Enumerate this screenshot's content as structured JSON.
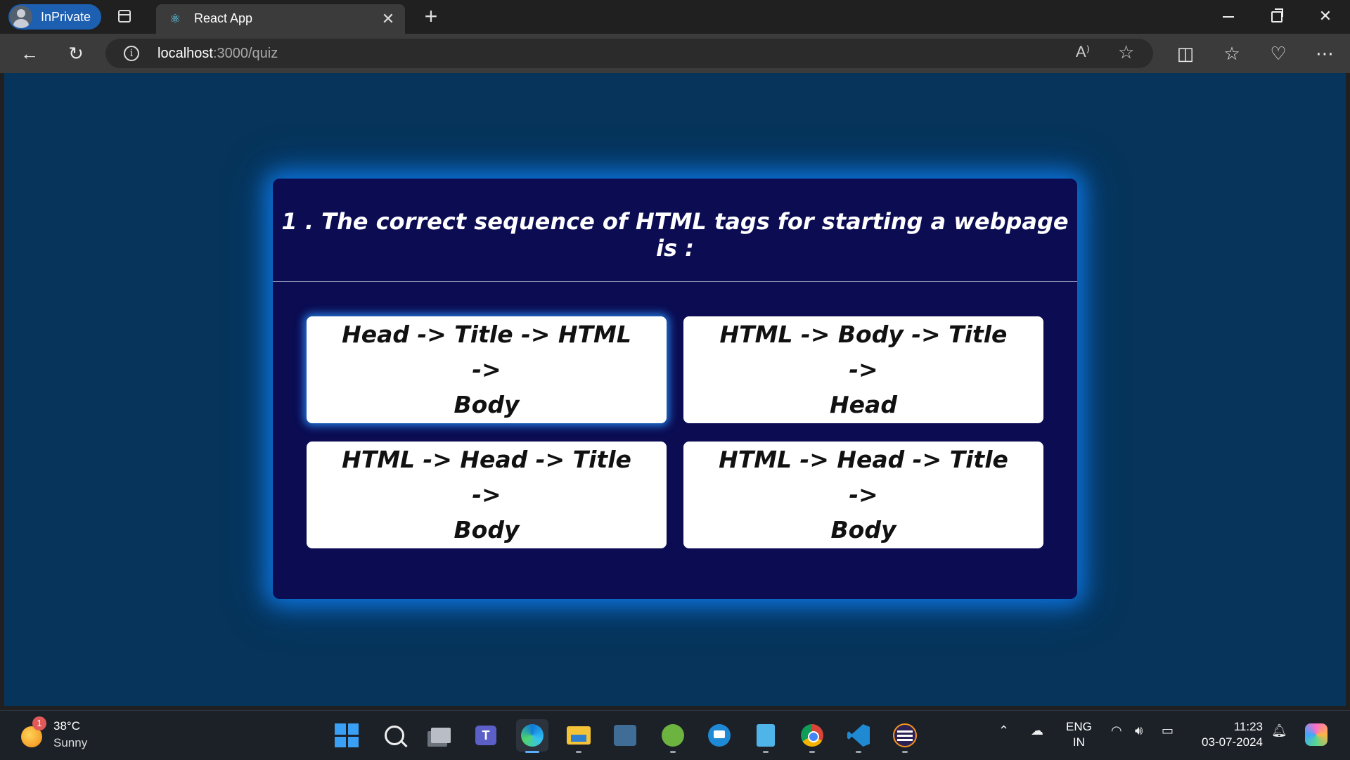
{
  "browser": {
    "profile_label": "InPrivate",
    "tab": {
      "title": "React App",
      "icon": "react-icon"
    },
    "address": {
      "host": "localhost",
      "path": ":3000/quiz"
    },
    "read_aloud_label": "A⁾",
    "window_controls": [
      "minimize",
      "restore",
      "close"
    ]
  },
  "quiz": {
    "question": "1 . The correct sequence of HTML tags for starting a webpage is :",
    "options": [
      {
        "line1": "Head -> Title -> HTML ->",
        "line2": "Body"
      },
      {
        "line1": "HTML -> Body -> Title ->",
        "line2": "Head"
      },
      {
        "line1": "HTML -> Head -> Title ->",
        "line2": "Body"
      },
      {
        "line1": "HTML -> Head -> Title ->",
        "line2": "Body"
      }
    ],
    "highlight_color": "#2896ff",
    "card_color": "#0b0c52",
    "page_bg": "#06345a"
  },
  "taskbar": {
    "weather": {
      "temp": "38°C",
      "condition": "Sunny",
      "badge": "1"
    },
    "language": {
      "line1": "ENG",
      "line2": "IN"
    },
    "clock": {
      "time": "11:23",
      "date": "03-07-2024"
    },
    "apps": [
      "start-icon",
      "search-icon",
      "task-view-icon",
      "teams-icon",
      "edge-icon",
      "file-explorer-icon",
      "mysql-workbench-icon",
      "spring-tool-suite-icon",
      "remote-desktop-icon",
      "notepad-icon",
      "chrome-icon",
      "vscode-icon",
      "eclipse-icon"
    ]
  }
}
